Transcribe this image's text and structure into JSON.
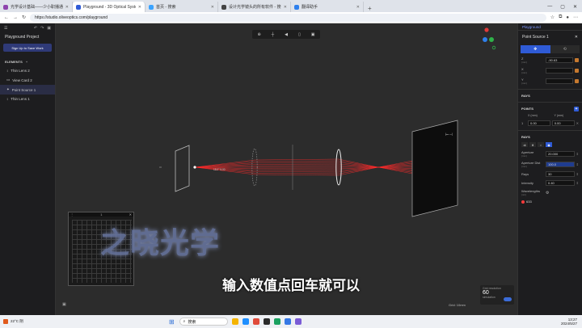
{
  "browser": {
    "tabs": [
      {
        "title": "光学设计基础——少小职播通出示",
        "color": "#8e44ad"
      },
      {
        "title": "Playground - 3D Optical System D",
        "color": "#2f5bd6"
      },
      {
        "title": "首页 - 搜索",
        "color": "#3aa3ff"
      },
      {
        "title": "设计光学镜头的所有软件 - 搜狐",
        "color": "#444444"
      },
      {
        "title": "翻译助手",
        "color": "#2f80ed"
      }
    ],
    "new_tab": "+",
    "url": "https://studio.oliveoptics.com/playground"
  },
  "left_panel": {
    "project": "Playground Project",
    "signup": "Sign Up to Save Work",
    "elements_label": "ELEMENTS",
    "add": "+",
    "items": [
      {
        "name": "Thin Lens 2",
        "icon": "↕"
      },
      {
        "name": "View Card 2",
        "icon": "▭"
      },
      {
        "name": "Point Source 1",
        "icon": "✦"
      },
      {
        "name": "Thin Lens 1",
        "icon": "↕"
      }
    ]
  },
  "viewport": {
    "toolbar": [
      "⊕",
      "┼",
      "◀",
      "▯",
      "▣"
    ],
    "annotation": "18.0° 5.00",
    "mini_label": "1",
    "resolution_label": "Grid resolution",
    "resolution": "60",
    "resolution_sub": "simulation",
    "footer": "Grid: 10mm"
  },
  "right_panel": {
    "tab": "Playground",
    "title": "Point Source 1",
    "close": "✕",
    "fields": [
      {
        "label": "Z",
        "sub": "(mm)",
        "value": "-90.63"
      },
      {
        "label": "X",
        "sub": "(mm)",
        "value": ""
      },
      {
        "label": "Y",
        "sub": "(mm)",
        "value": ""
      }
    ],
    "rays_header": "RAYS",
    "points_header": "POINTS",
    "point_cols": [
      "X (mm)",
      "Y (mm)"
    ],
    "point_row": {
      "idx": "1",
      "x": "0.00",
      "y": "0.00"
    },
    "rays_sub": "RAYS",
    "params": [
      {
        "label": "Aperture",
        "sub": "(mm)",
        "value": "20.000"
      },
      {
        "label": "Aperture Dist",
        "sub": "(mm)",
        "value": "100.0"
      },
      {
        "label": "Rays",
        "sub": "",
        "value": "30"
      },
      {
        "label": "Intensity",
        "sub": "",
        "value": "0.40"
      }
    ],
    "wavelength_label": "Wavelengths",
    "wavelength_sub": "(nm)",
    "wavelength": "633",
    "ray_color": "#ff2a2a"
  },
  "overlay": {
    "watermark": "之晓光学",
    "subtitle": "输入数值点回车就可以"
  },
  "taskbar": {
    "weather": "22°C 阴",
    "search": "搜索",
    "time": "13:27",
    "date": "2024/5/27"
  }
}
